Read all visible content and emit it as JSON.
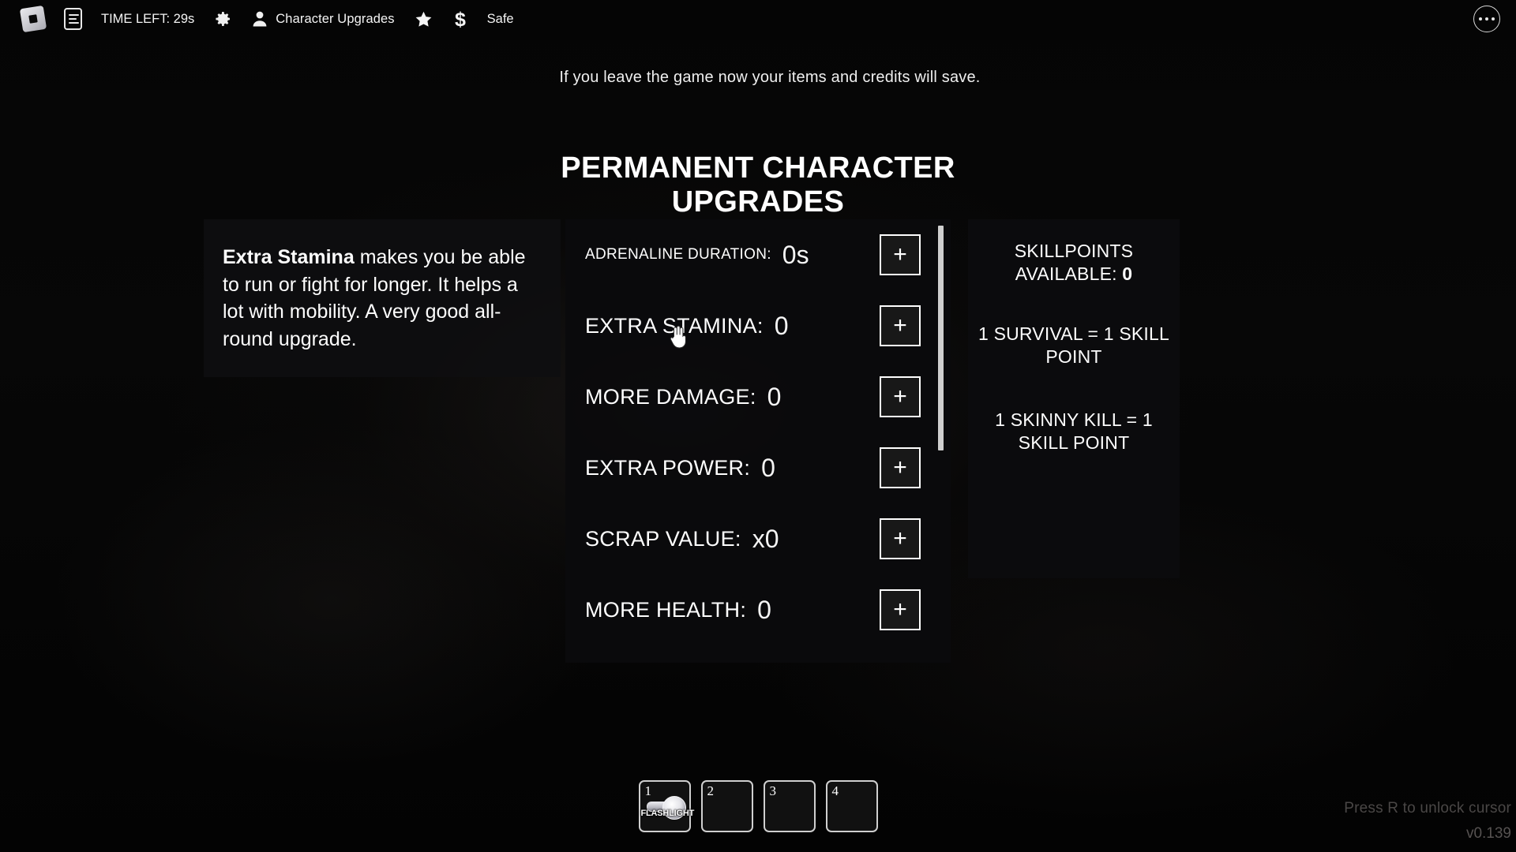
{
  "topbar": {
    "items": [
      {
        "name": "roblox-logo",
        "icon": "roblox-logo-icon",
        "label": ""
      },
      {
        "name": "menu-list",
        "icon": "document-list-icon",
        "label": ""
      },
      {
        "name": "time-left",
        "icon": "",
        "label": "TIME LEFT: 29s"
      },
      {
        "name": "settings",
        "icon": "gear-icon",
        "label": ""
      },
      {
        "name": "character-upgrades",
        "icon": "person-icon",
        "label": "Character Upgrades"
      },
      {
        "name": "favorites",
        "icon": "star-icon",
        "label": ""
      },
      {
        "name": "currency",
        "icon": "dollar-icon",
        "label": ""
      },
      {
        "name": "safe",
        "icon": "",
        "label": "Safe"
      }
    ],
    "more_menu": "more-options-icon"
  },
  "notice": {
    "text": "If you leave the game now your items and credits will save."
  },
  "title": {
    "line1": "PERMANENT CHARACTER",
    "line2": "UPGRADES"
  },
  "description": {
    "highlight": "Extra Stamina",
    "body": " makes you be able to run or fight for longer. It helps a lot with mobility. A very good all-round upgrade."
  },
  "upgrades": {
    "plus_label": "+",
    "rows": [
      {
        "label": "ADRENALINE DURATION:",
        "value": "0s",
        "small": true
      },
      {
        "label": "EXTRA STAMINA:",
        "value": "0",
        "small": false
      },
      {
        "label": "MORE DAMAGE:",
        "value": "0",
        "small": false
      },
      {
        "label": "EXTRA POWER:",
        "value": "0",
        "small": false
      },
      {
        "label": "SCRAP VALUE:",
        "value": "x0",
        "small": false
      },
      {
        "label": "MORE HEALTH:",
        "value": "0",
        "small": false
      }
    ]
  },
  "skillpoints": {
    "header_text": "SKILLPOINTS AVAILABLE: ",
    "available": "0",
    "rule_1": "1 SURVIVAL = 1 SKILL POINT",
    "rule_2": "1 SKINNY KILL = 1 SKILL POINT"
  },
  "hotbar": {
    "slots": [
      {
        "number": "1",
        "item": "FLASHLIGHT",
        "has_item": true
      },
      {
        "number": "2",
        "item": "",
        "has_item": false
      },
      {
        "number": "3",
        "item": "",
        "has_item": false
      },
      {
        "number": "4",
        "item": "",
        "has_item": false
      }
    ]
  },
  "hints": {
    "unlock_cursor": "Press R to unlock cursor",
    "version": "v0.139"
  },
  "colors": {
    "background": "#000000",
    "panel": "#0b0b0d",
    "text": "#ffffff",
    "hint": "#4a4746"
  }
}
